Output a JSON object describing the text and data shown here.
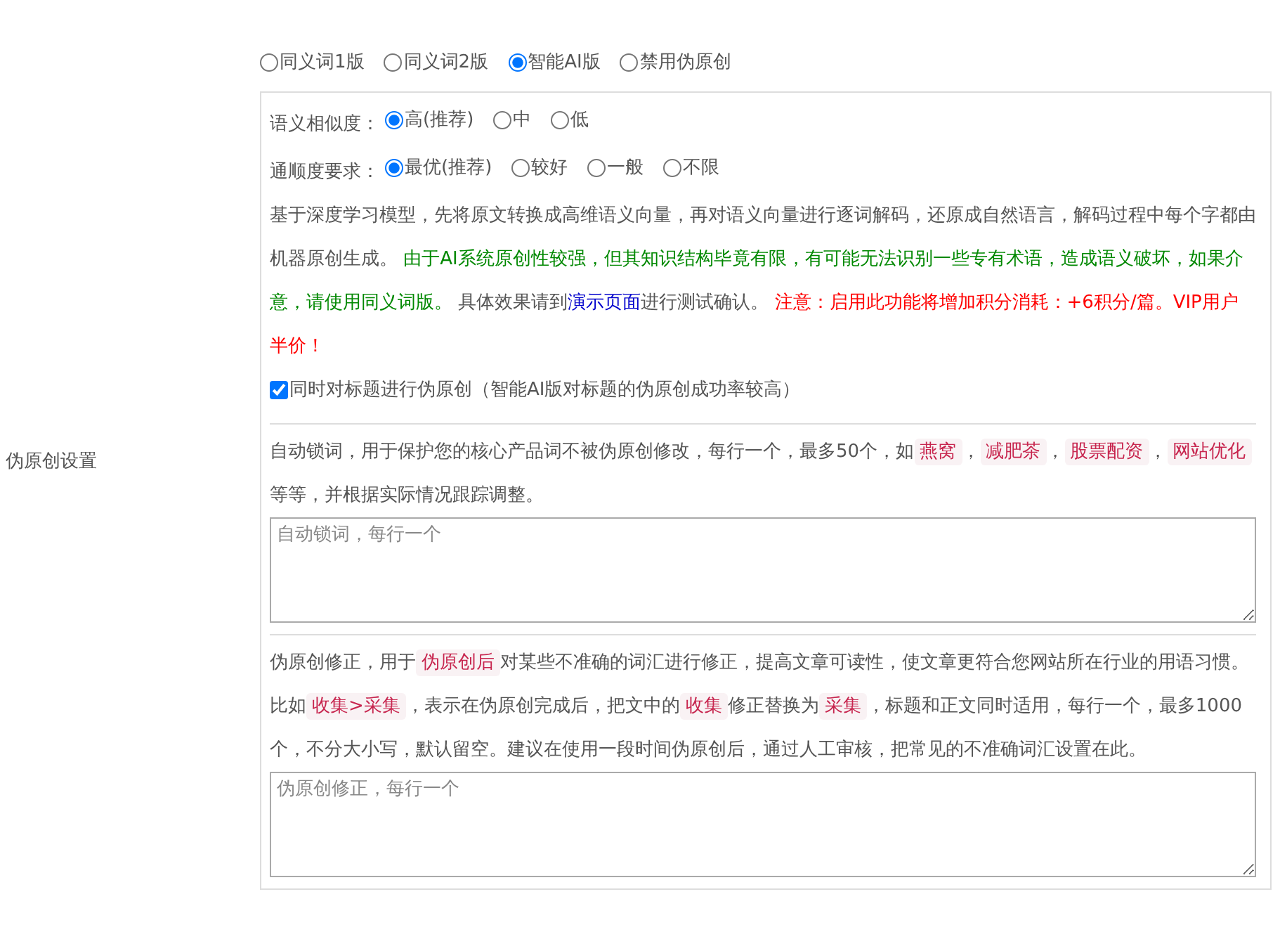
{
  "sidebar_label": "伪原创设置",
  "modes": [
    {
      "label": "同义词1版",
      "selected": false
    },
    {
      "label": "同义词2版",
      "selected": false
    },
    {
      "label": "智能AI版",
      "selected": true
    },
    {
      "label": "禁用伪原创",
      "selected": false
    }
  ],
  "similarity": {
    "label": "语义相似度：",
    "options": [
      {
        "label": "高(推荐)",
        "selected": true
      },
      {
        "label": "中",
        "selected": false
      },
      {
        "label": "低",
        "selected": false
      }
    ]
  },
  "fluency": {
    "label": "通顺度要求：",
    "options": [
      {
        "label": "最优(推荐)",
        "selected": true
      },
      {
        "label": "较好",
        "selected": false
      },
      {
        "label": "一般",
        "selected": false
      },
      {
        "label": "不限",
        "selected": false
      }
    ]
  },
  "ai_description": [
    {
      "kind": "text",
      "text": "基于深度学习模型，先将原文转换成高维语义向量，再对语义向量进行逐词解码，还原成自然语言，解码过程中每个字都由机器原创生成。 "
    },
    {
      "kind": "notice",
      "text": "由于AI系统原创性较强，但其知识结构毕竟有限，有可能无法识别一些专有术语，造成语义破坏，如果介意，请使用同义词版。"
    },
    {
      "kind": "text",
      "text": " 具体效果请到"
    },
    {
      "kind": "link",
      "text": "演示页面"
    },
    {
      "kind": "text",
      "text": "进行测试确认。 "
    },
    {
      "kind": "warning",
      "text": "注意：启用此功能将增加积分消耗：+6积分/篇。VIP用户半价！"
    }
  ],
  "title_option": {
    "label": "同时对标题进行伪原创（智能AI版对标题的伪原创成功率较高）",
    "checked": true
  },
  "lock_words": {
    "description": [
      {
        "kind": "text",
        "text": "自动锁词，用于保护您的核心产品词不被伪原创修改，每行一个，最多50个，如"
      },
      {
        "kind": "code",
        "text": "燕窝"
      },
      {
        "kind": "text",
        "text": "，"
      },
      {
        "kind": "code",
        "text": "减肥茶"
      },
      {
        "kind": "text",
        "text": "，"
      },
      {
        "kind": "code",
        "text": "股票配资"
      },
      {
        "kind": "text",
        "text": "，"
      },
      {
        "kind": "code",
        "text": "网站优化"
      },
      {
        "kind": "text",
        "text": " 等等，并根据实际情况跟踪调整。"
      }
    ],
    "placeholder": "自动锁词，每行一个"
  },
  "corrections": {
    "description": [
      {
        "kind": "text",
        "text": "伪原创修正，用于"
      },
      {
        "kind": "code",
        "text": "伪原创后"
      },
      {
        "kind": "text",
        "text": "对某些不准确的词汇进行修正，提高文章可读性，使文章更符合您网站所在行业的用语习惯。比如"
      },
      {
        "kind": "code",
        "text": "收集>采集"
      },
      {
        "kind": "text",
        "text": "，表示在伪原创完成后，把文中的"
      },
      {
        "kind": "code",
        "text": "收集"
      },
      {
        "kind": "text",
        "text": "修正替换为"
      },
      {
        "kind": "code",
        "text": "采集"
      },
      {
        "kind": "text",
        "text": "，标题和正文同时适用，每行一个，最多1000个，不分大小写，默认留空。建议在使用一段时间伪原创后，通过人工审核，把常见的不准确词汇设置在此。"
      }
    ],
    "placeholder": "伪原创修正，每行一个"
  }
}
